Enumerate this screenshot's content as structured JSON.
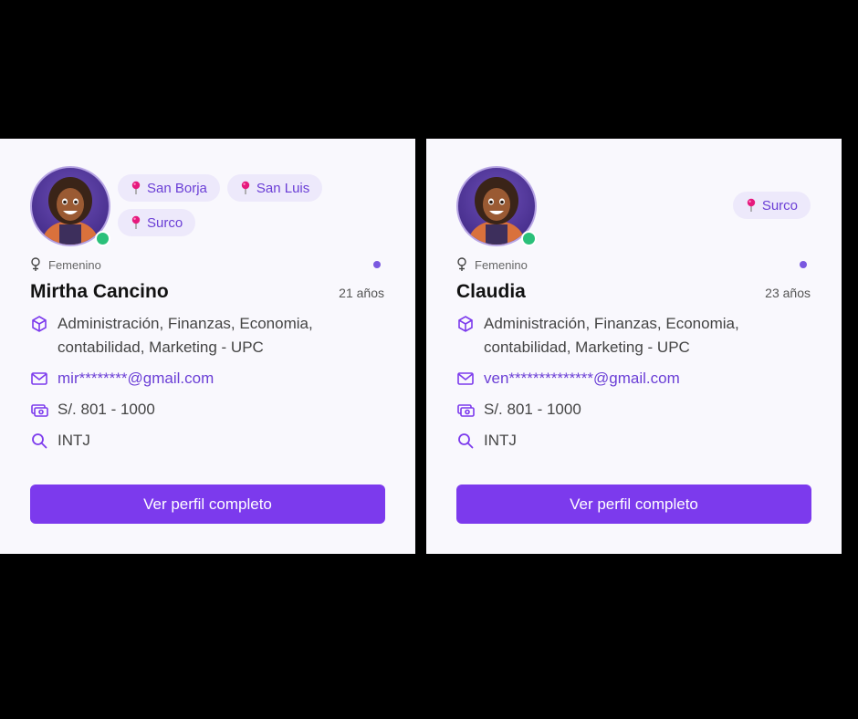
{
  "cards": [
    {
      "locations": [
        "San Borja",
        "San Luis",
        "Surco"
      ],
      "gender": "Femenino",
      "name": "Mirtha Cancino",
      "age": "21 años",
      "career": "Administración, Finanzas, Economia, contabilidad, Marketing - UPC",
      "email": "mir********@gmail.com",
      "salary": "S/. 801 - 1000",
      "personality": "INTJ",
      "button_label": "Ver perfil completo"
    },
    {
      "locations": [
        "Surco"
      ],
      "gender": "Femenino",
      "name": "Claudia",
      "age": "23 años",
      "career": "Administración, Finanzas, Economia, contabilidad, Marketing - UPC",
      "email": "ven**************@gmail.com",
      "salary": "S/. 801 - 1000",
      "personality": "INTJ",
      "button_label": "Ver perfil completo"
    }
  ],
  "icons": {
    "location": "pin-icon",
    "gender": "female-icon",
    "career": "cube-icon",
    "email": "mail-icon",
    "salary": "money-icon",
    "personality": "search-icon"
  },
  "colors": {
    "accent": "#7c3aed",
    "tag_bg": "#ede9fb",
    "pin": "#e6197d",
    "online": "#2bc07a"
  }
}
